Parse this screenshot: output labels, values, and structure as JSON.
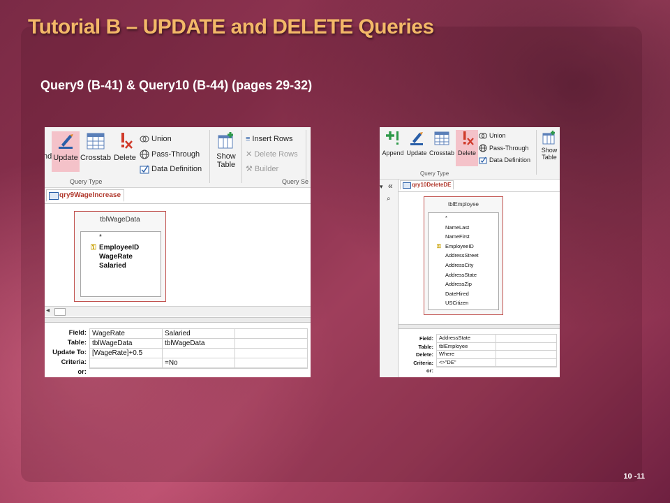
{
  "slide": {
    "title": "Tutorial B – UPDATE and DELETE  Queries",
    "subtitle": "Query9 (B-41) & Query10 (B-44) (pages 29-32)",
    "slide_number": "10 -11"
  },
  "left_shot": {
    "ribbon": {
      "partial_label": "nd",
      "update": "Update",
      "crosstab": "Crosstab",
      "delete": "Delete",
      "union": "Union",
      "pass_through": "Pass-Through",
      "data_definition": "Data Definition",
      "show_table_line1": "Show",
      "show_table_line2": "Table",
      "insert_rows": "Insert Rows",
      "delete_rows": "Delete Rows",
      "builder": "Builder",
      "group_query_type": "Query Type",
      "group_query_setup": "Query Se"
    },
    "tab_label": "qry9WageIncrease",
    "table": {
      "name": "tblWageData",
      "fields": [
        "*",
        "EmployeeID",
        "WageRate",
        "Salaried"
      ]
    },
    "grid": {
      "row_labels": [
        "Field:",
        "Table:",
        "Update To:",
        "Criteria:",
        "or:"
      ],
      "columns": [
        [
          "WageRate",
          "tblWageData",
          "[WageRate]+0.5",
          "",
          ""
        ],
        [
          "Salaried",
          "tblWageData",
          "",
          "=No",
          ""
        ],
        [
          "",
          "",
          "",
          "",
          ""
        ]
      ]
    }
  },
  "right_shot": {
    "ribbon": {
      "append": "Append",
      "update": "Update",
      "crosstab": "Crosstab",
      "delete": "Delete",
      "union": "Union",
      "pass_through": "Pass-Through",
      "data_definition": "Data Definition",
      "show_table_line1": "Show",
      "show_table_line2": "Table",
      "group_query_type": "Query Type"
    },
    "nav": {
      "collapse": "«"
    },
    "tab_label": "qry10DeleteDE",
    "table": {
      "name": "tblEmployee",
      "fields": [
        "*",
        "NameLast",
        "NameFirst",
        "EmployeeID",
        "AddressStreet",
        "AddressCity",
        "AddressState",
        "AddressZip",
        "DateHired",
        "USCitizen"
      ]
    },
    "grid": {
      "row_labels": [
        "Field:",
        "Table:",
        "Delete:",
        "Criteria:",
        "or:"
      ],
      "columns": [
        [
          "AddressState",
          "tblEmployee",
          "Where",
          "<>\"DE\"",
          ""
        ],
        [
          "",
          "",
          "",
          "",
          ""
        ]
      ]
    }
  },
  "icons": {
    "update": "update-query-icon",
    "crosstab": "crosstab-icon",
    "delete": "delete-query-icon",
    "append": "append-query-icon",
    "show_table": "show-table-icon",
    "key": "primary-key-icon"
  },
  "colors": {
    "title": "#f3b868",
    "active_button": "#f4c2c9",
    "tab_text": "#b13a2e",
    "table_border": "#c0504d"
  }
}
